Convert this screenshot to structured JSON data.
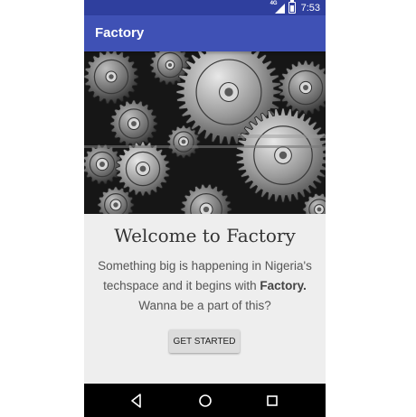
{
  "status_bar": {
    "network_label": "4G",
    "time": "7:53"
  },
  "app_bar": {
    "title": "Factory"
  },
  "hero": {
    "image_subject": "industrial-gears"
  },
  "welcome": {
    "title": "Welcome to Factory",
    "text_prefix": "Something big is happening in Nigeria's techspace and it begins with ",
    "text_bold": "Factory.",
    "text_suffix": " Wanna be a part of this?"
  },
  "button": {
    "get_started_label": "GET STARTED"
  },
  "nav": {
    "icons": [
      "back-icon",
      "home-icon",
      "recent-apps-icon"
    ]
  },
  "colors": {
    "status_bar": "#2f3f9e",
    "app_bar": "#3f51b5",
    "background": "#eeeeee",
    "nav_bar": "#000000"
  }
}
